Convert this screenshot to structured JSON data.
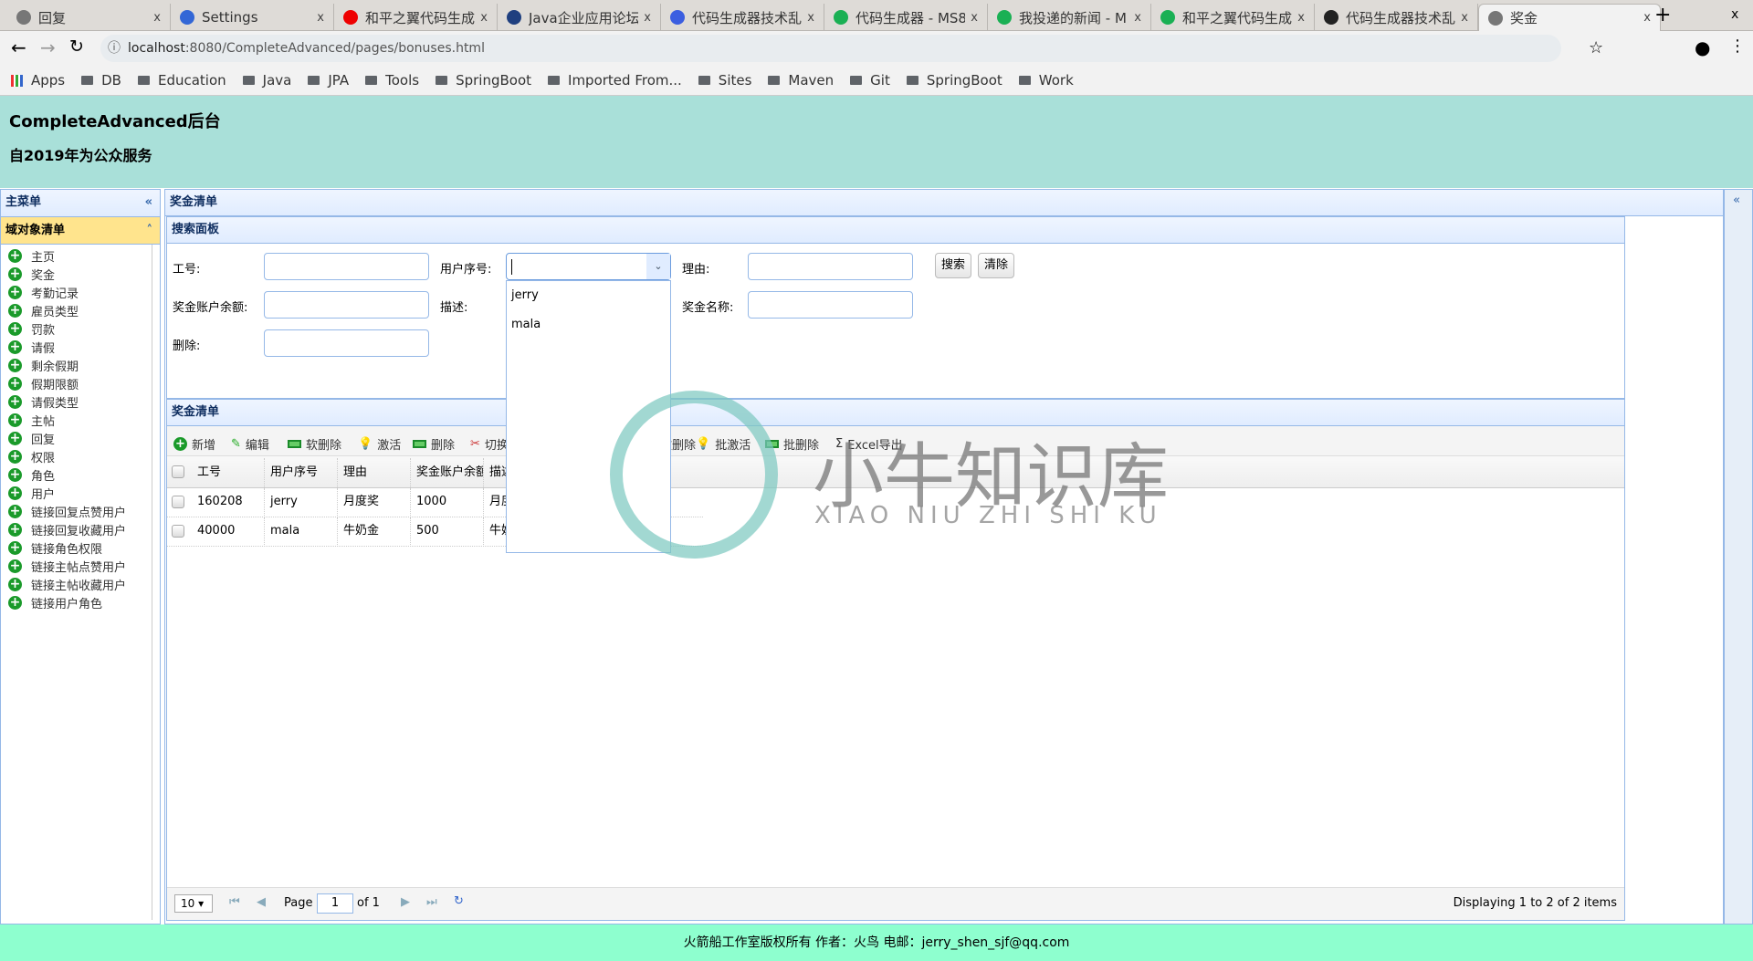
{
  "browser": {
    "tabs": [
      {
        "label": "回复",
        "icon": "page-icon",
        "color": "#777"
      },
      {
        "label": "Settings",
        "icon": "gear-icon",
        "color": "#3367d6"
      },
      {
        "label": "和平之翼代码生成",
        "icon": "g-logo-icon",
        "color": "#e00"
      },
      {
        "label": "Java企业应用论坛",
        "icon": "c-logo-icon",
        "color": "#1f3f7f"
      },
      {
        "label": "代码生成器技术乱",
        "icon": "baidu-paw-icon",
        "color": "#3b5ee0"
      },
      {
        "label": "代码生成器 - MS8",
        "icon": "c-green-icon",
        "color": "#1ab054"
      },
      {
        "label": "我投递的新闻 - M",
        "icon": "c-green-icon",
        "color": "#1ab054"
      },
      {
        "label": "和平之翼代码生成",
        "icon": "c-green-icon",
        "color": "#1ab054"
      },
      {
        "label": "代码生成器技术乱",
        "icon": "money-bag-icon",
        "color": "#222"
      },
      {
        "label": "奖金",
        "icon": "page-icon",
        "color": "#777",
        "active": true
      }
    ],
    "url_host": "localhost",
    "url_rest": ":8080/CompleteAdvanced/pages/bonuses.html",
    "bookmarks": [
      "Apps",
      "DB",
      "Education",
      "Java",
      "JPA",
      "Tools",
      "SpringBoot",
      "Imported From...",
      "Sites",
      "Maven",
      "Git",
      "SpringBoot",
      "Work"
    ]
  },
  "header": {
    "title": "CompleteAdvanced后台",
    "subtitle": "自2019年为公众服务"
  },
  "sidebar": {
    "title": "主菜单",
    "section": "域对象清单",
    "items": [
      "主页",
      "奖金",
      "考勤记录",
      "雇员类型",
      "罚款",
      "请假",
      "剩余假期",
      "假期限额",
      "请假类型",
      "主帖",
      "回复",
      "权限",
      "角色",
      "用户",
      "链接回复点赞用户",
      "链接回复收藏用户",
      "链接角色权限",
      "链接主帖点赞用户",
      "链接主帖收藏用户",
      "链接用户角色"
    ]
  },
  "main": {
    "title": "奖金清单",
    "search": {
      "title": "搜索面板",
      "labels": {
        "id": "工号:",
        "user": "用户序号:",
        "reason": "理由:",
        "balance": "奖金账户余额:",
        "desc": "描述:",
        "name": "奖金名称:",
        "deleted": "删除:"
      },
      "search_btn": "搜索",
      "clear_btn": "清除",
      "user_value": "",
      "user_options": [
        "jerry",
        "mala"
      ]
    },
    "grid": {
      "title": "奖金清单",
      "toolbar": [
        "新增",
        "编辑",
        "软删除",
        "激活",
        "删除",
        "切换",
        "批软删除",
        "批激活",
        "批删除",
        "Excel导出"
      ],
      "columns": [
        "工号",
        "用户序号",
        "理由",
        "奖金账户余额",
        "描述"
      ],
      "rows": [
        [
          "160208",
          "jerry",
          "月度奖",
          "1000",
          "月度奖"
        ],
        [
          "40000",
          "mala",
          "牛奶金",
          "500",
          "牛奶金"
        ]
      ],
      "pager": {
        "page_size": "10",
        "page_label": "Page",
        "page": "1",
        "of": "of 1",
        "info": "Displaying 1 to 2 of 2 items"
      }
    }
  },
  "footer": "火箭船工作室版权所有 作者：火鸟 电邮：jerry_shen_sjf@qq.com",
  "watermark": {
    "cn": "小牛知识库",
    "en": "XIAO NIU ZHI SHI KU"
  }
}
